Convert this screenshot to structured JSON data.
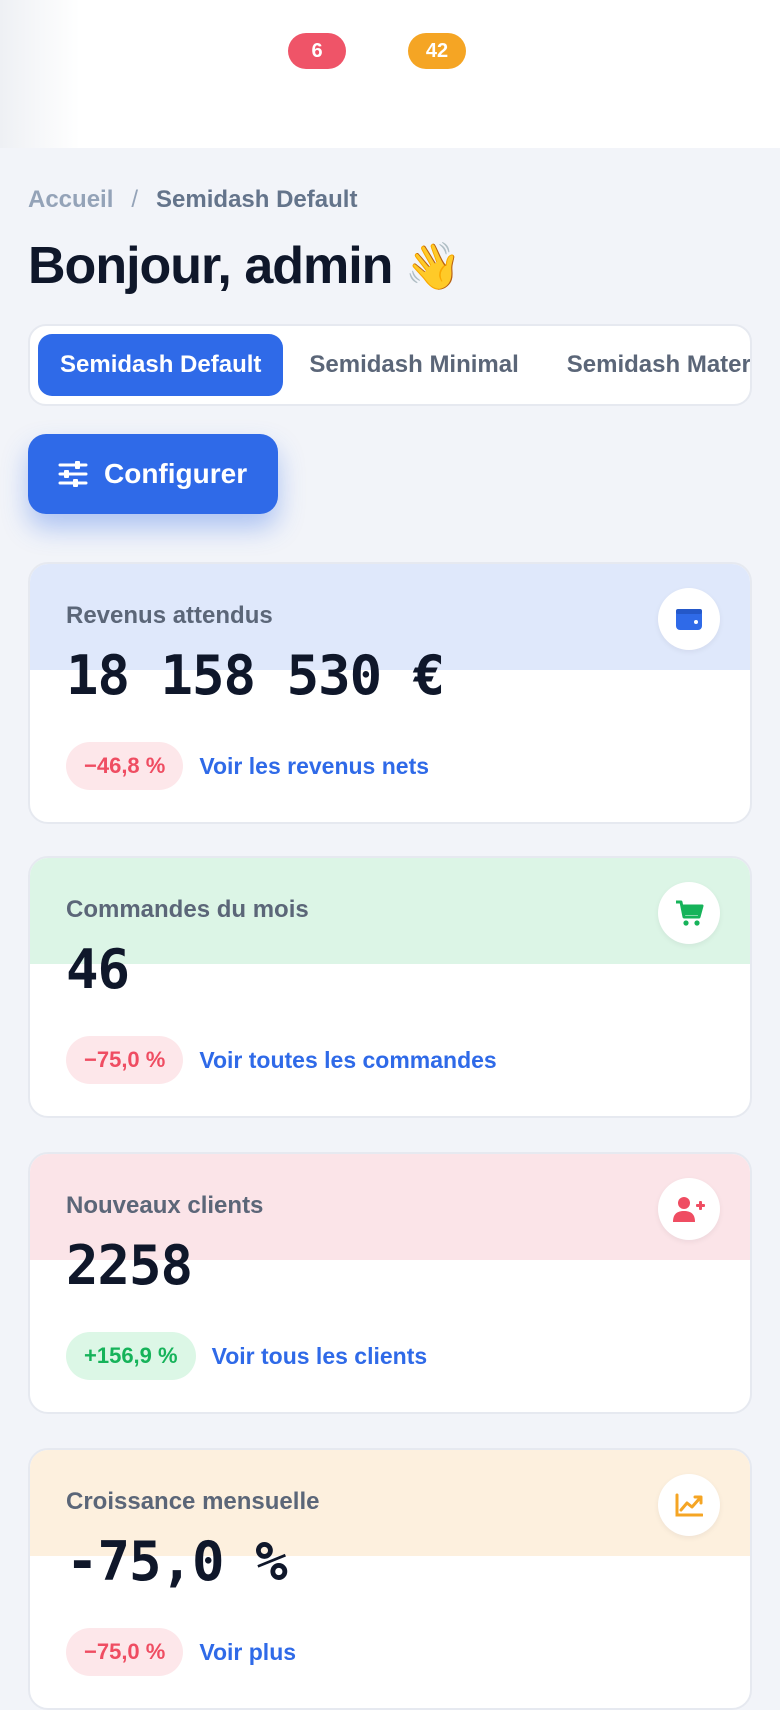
{
  "topbar": {
    "badge_red": "6",
    "badge_orange": "42"
  },
  "breadcrumb": {
    "home": "Accueil",
    "separator": "/",
    "current": "Semidash Default"
  },
  "greeting": {
    "title": "Bonjour, admin",
    "emoji": "👋"
  },
  "tabs": [
    {
      "label": "Semidash Default",
      "active": true
    },
    {
      "label": "Semidash Minimal",
      "active": false
    },
    {
      "label": "Semidash Material",
      "active": false
    }
  ],
  "configure_button": {
    "label": "Configurer",
    "icon": "sliders-icon"
  },
  "stats": [
    {
      "label": "Revenus attendus",
      "value": "18 158 530 €",
      "change": "−46,8 %",
      "trend": "negative",
      "link": "Voir les revenus nets",
      "icon": "wallet-icon",
      "band_color": "#dfe8fb",
      "icon_color": "#2f6ae8"
    },
    {
      "label": "Commandes du mois",
      "value": "46",
      "change": "−75,0 %",
      "trend": "negative",
      "link": "Voir toutes les commandes",
      "icon": "cart-icon",
      "band_color": "#dcf5e6",
      "icon_color": "#16b35a"
    },
    {
      "label": "Nouveaux clients",
      "value": "2258",
      "change": "+156,9 %",
      "trend": "positive",
      "link": "Voir tous les clients",
      "icon": "user-plus-icon",
      "band_color": "#fbe4e8",
      "icon_color": "#ef4d62"
    },
    {
      "label": "Croissance mensuelle",
      "value": "-75,0 %",
      "change": "−75,0 %",
      "trend": "negative",
      "link": "Voir plus",
      "icon": "trend-chart-icon",
      "band_color": "#fdf0de",
      "icon_color": "#f5a524"
    }
  ]
}
